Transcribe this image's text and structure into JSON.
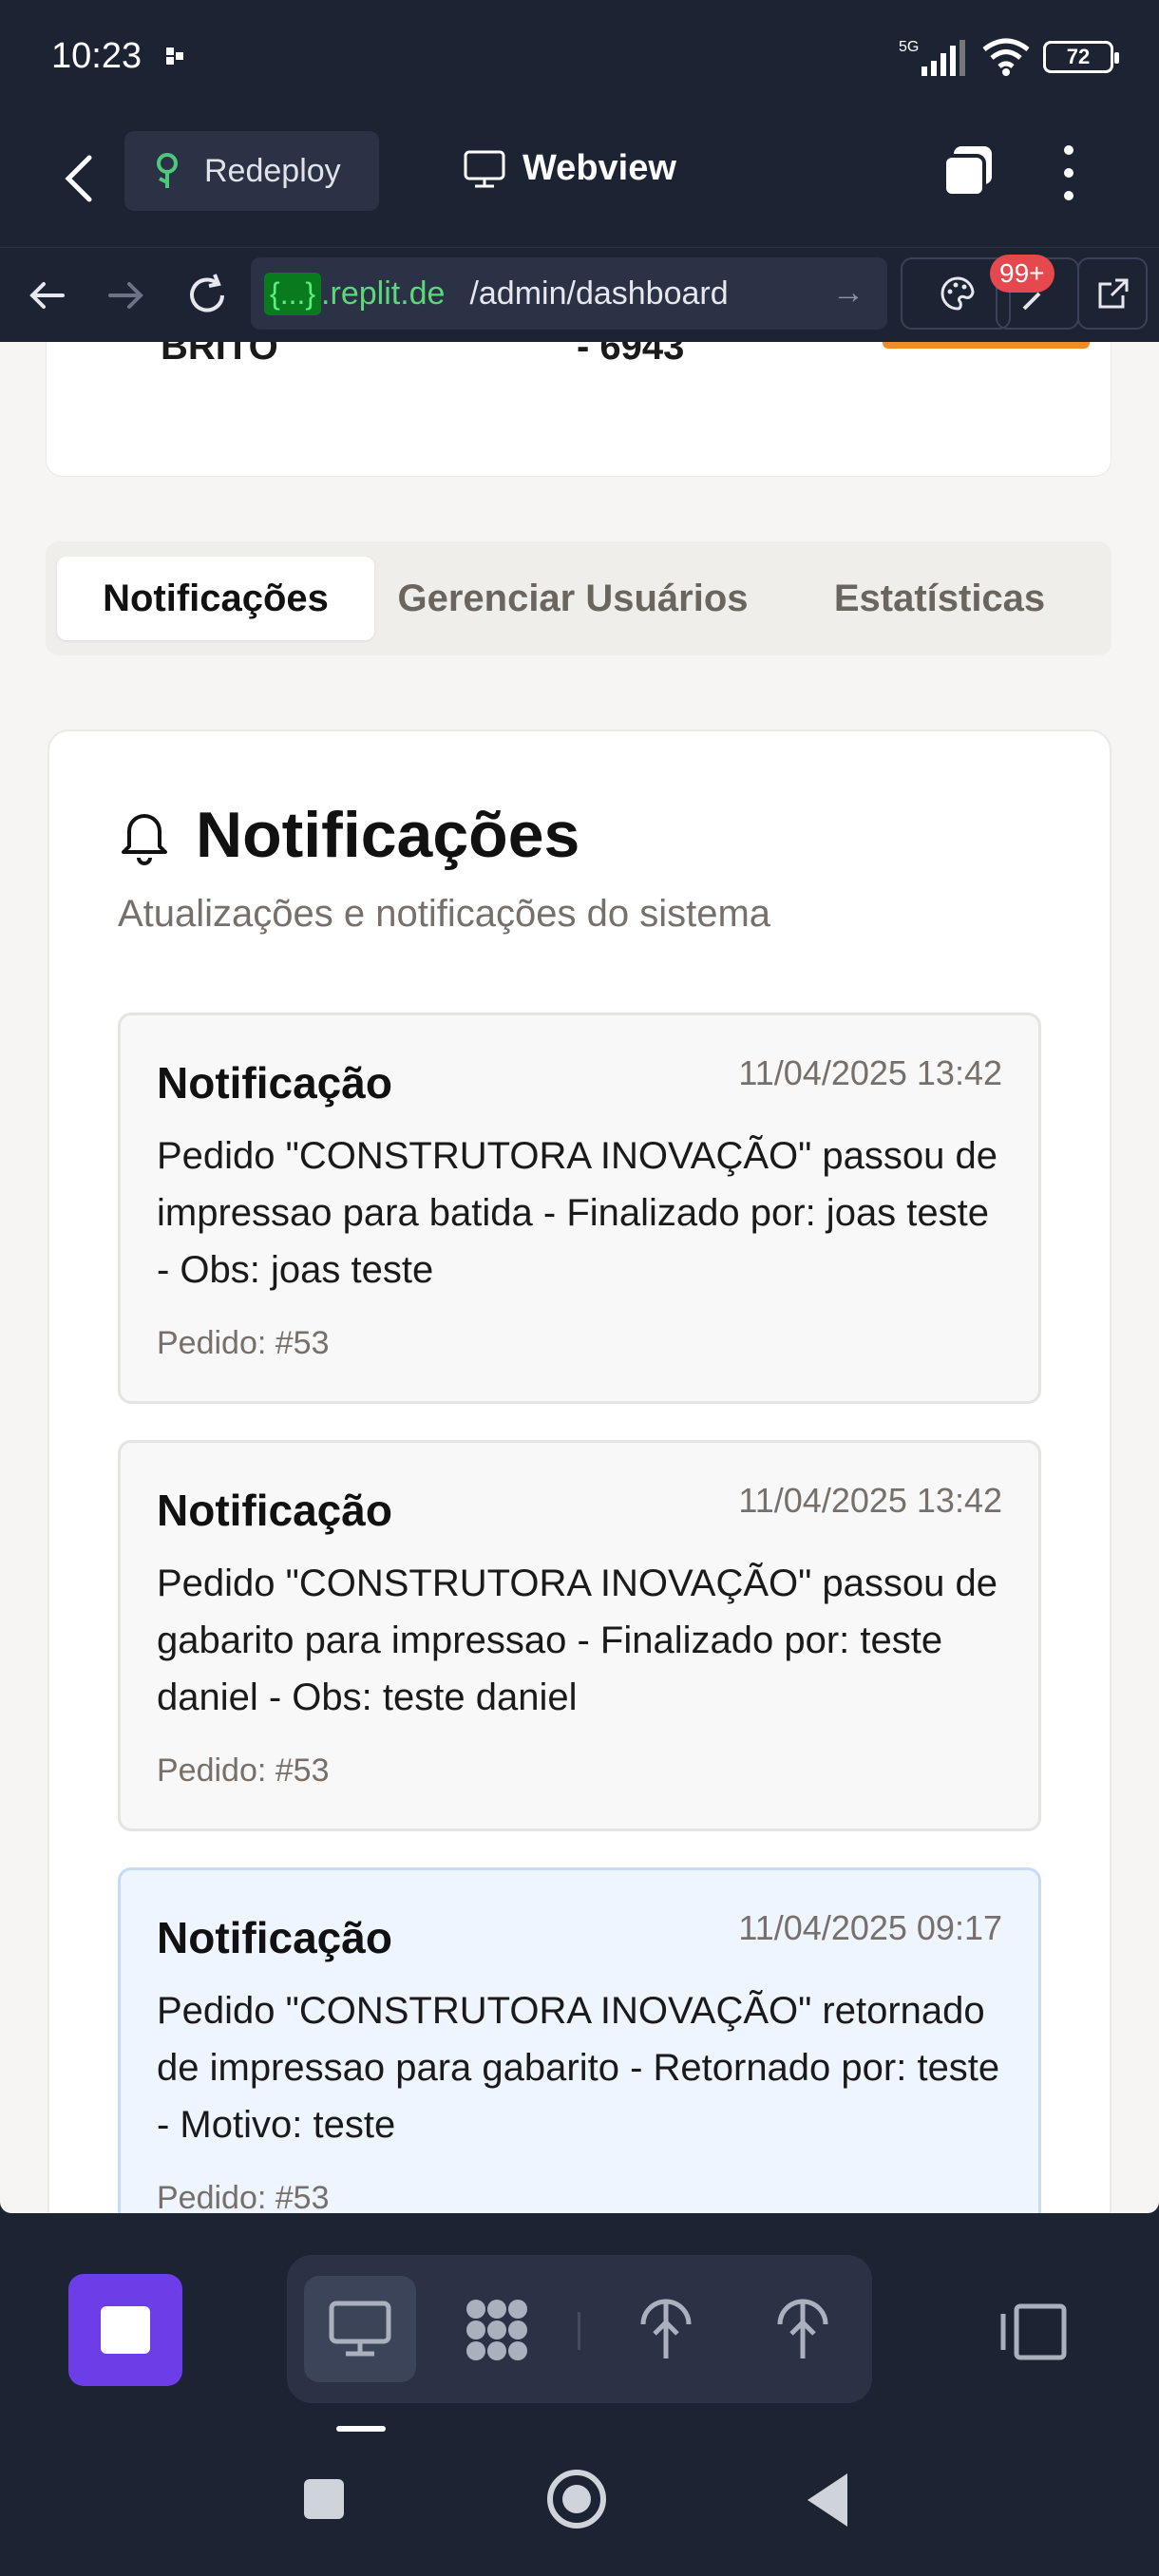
{
  "status": {
    "time": "10:23",
    "network": "5G",
    "battery": "72"
  },
  "appbar": {
    "project": "Redeploy",
    "view_label": "Webview"
  },
  "browser": {
    "url_chip": "{...}",
    "url_domain": ".replit.de",
    "url_path": "/admin/dashboard",
    "badge": "99+"
  },
  "previous_card": {
    "left_text": "BRITO",
    "right_text": "- 6943"
  },
  "tabs": [
    {
      "label": "Notificações",
      "active": true
    },
    {
      "label": "Gerenciar Usuários",
      "active": false
    },
    {
      "label": "Estatísticas",
      "active": false
    }
  ],
  "panel": {
    "title": "Notificações",
    "description": "Atualizações e notificações do sistema"
  },
  "notifications": [
    {
      "title": "Notificação",
      "date": "11/04/2025 13:42",
      "message": "Pedido \"CONSTRUTORA INOVAÇÃO\" passou de impressao para batida - Finalizado por: joas teste - Obs: joas teste",
      "order": "Pedido: #53",
      "unread": false
    },
    {
      "title": "Notificação",
      "date": "11/04/2025 13:42",
      "message": "Pedido \"CONSTRUTORA INOVAÇÃO\" passou de gabarito para impressao - Finalizado por: teste daniel - Obs: teste daniel",
      "order": "Pedido: #53",
      "unread": false
    },
    {
      "title": "Notificação",
      "date": "11/04/2025 09:17",
      "message": "Pedido \"CONSTRUTORA INOVAÇÃO\" retornado de impressao para gabarito - Retornado por: teste - Motivo: teste",
      "order": "Pedido: #53",
      "unread": true
    }
  ],
  "icons": {
    "back": "chevron-left-icon",
    "project": "tree-icon",
    "webview": "monitor-icon",
    "tabs": "tabs-icon",
    "more": "more-vertical-icon",
    "bell": "bell-icon"
  },
  "colors": {
    "accent": "#6d3de8",
    "chrome": "#1c2333",
    "unread_bg": "#eef5ff"
  }
}
